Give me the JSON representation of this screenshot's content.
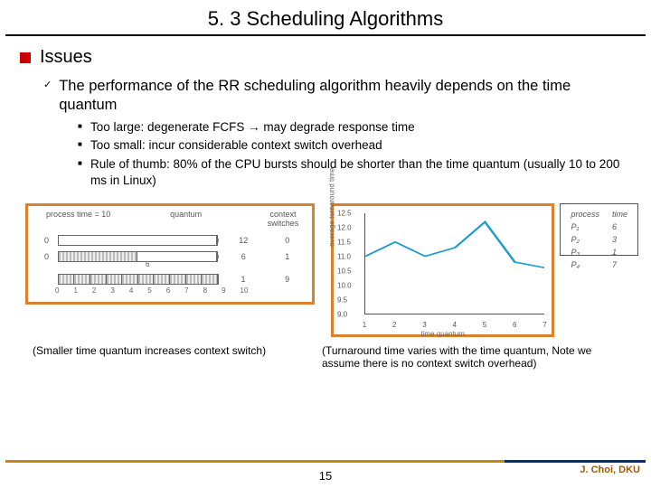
{
  "title": "5. 3 Scheduling Algorithms",
  "section": "Issues",
  "sub1": "The performance of the RR scheduling algorithm heavily depends on the time quantum",
  "bullets": [
    "Too large: degenerate FCFS → may degrade response time",
    "Too small: incur considerable context switch overhead",
    "Rule of thumb: 80% of the CPU bursts should be shorter than the time quantum (usually 10 to 200 ms in Linux)"
  ],
  "left_fig": {
    "header_left": "process time = 10",
    "header_q": "quantum",
    "header_cs": "context switches",
    "rows": [
      {
        "quantum": "12",
        "cs": "0",
        "segments": 1
      },
      {
        "quantum": "6",
        "cs": "1",
        "segments": 2
      },
      {
        "quantum": "1",
        "cs": "9",
        "segments": 10
      }
    ],
    "xticks": [
      "0",
      "1",
      "2",
      "3",
      "4",
      "5",
      "6",
      "7",
      "8",
      "9",
      "10"
    ],
    "mid_mark": "10",
    "six_mark": "6"
  },
  "caption_left": "(Smaller time quantum increases context switch)",
  "caption_right": "(Turnaround time varies with the time quantum, Note we assume there is no context switch overhead)",
  "chart_data": {
    "type": "line",
    "xlabel": "time quantum",
    "ylabel": "average turnaround time",
    "x": [
      1,
      2,
      3,
      4,
      5,
      6,
      7
    ],
    "y": [
      11.0,
      11.5,
      11.0,
      11.3,
      12.2,
      10.8,
      10.6
    ],
    "ylim": [
      9.0,
      12.5
    ],
    "yticks": [
      9.0,
      9.5,
      10.0,
      10.5,
      11.0,
      11.5,
      12.0,
      12.5
    ],
    "xticks": [
      1,
      2,
      3,
      4,
      5,
      6,
      7
    ]
  },
  "process_table": {
    "headers": [
      "process",
      "time"
    ],
    "rows": [
      [
        "P₁",
        "6"
      ],
      [
        "P₂",
        "3"
      ],
      [
        "P₃",
        "1"
      ],
      [
        "P₄",
        "7"
      ]
    ]
  },
  "author": "J. Choi, DKU",
  "page": "15"
}
